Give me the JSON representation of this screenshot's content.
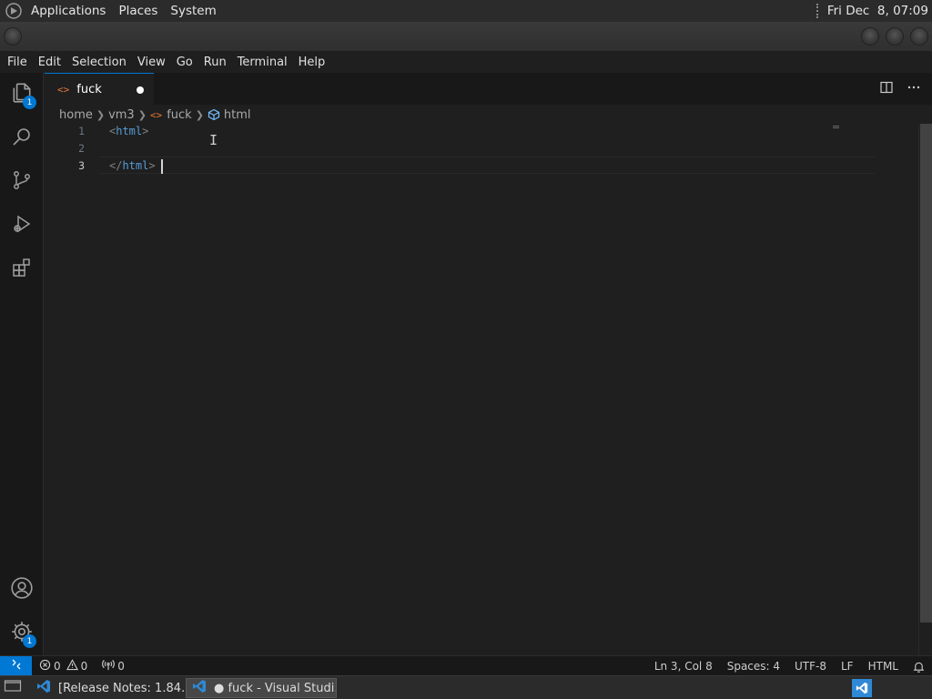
{
  "system_panel": {
    "menus": [
      "Applications",
      "Places",
      "System"
    ],
    "clock": "Fri Dec  8, 07:09"
  },
  "menubar": {
    "items": [
      "File",
      "Edit",
      "Selection",
      "View",
      "Go",
      "Run",
      "Terminal",
      "Help"
    ]
  },
  "activity_bar": {
    "items": [
      {
        "icon": "files-icon",
        "badge": "1"
      },
      {
        "icon": "search-icon"
      },
      {
        "icon": "source-control-icon"
      },
      {
        "icon": "run-debug-icon"
      },
      {
        "icon": "extensions-icon"
      }
    ],
    "bottom": [
      {
        "icon": "account-icon"
      },
      {
        "icon": "manage-gear-icon",
        "badge": "1"
      }
    ]
  },
  "tab": {
    "icon_glyph": "<>",
    "label": "fuck",
    "dirty": true
  },
  "breadcrumb": {
    "items": [
      "home",
      "vm3",
      "fuck",
      "html"
    ]
  },
  "editor": {
    "lines": [
      {
        "number": "1",
        "text": "<html>"
      },
      {
        "number": "2",
        "text": ""
      },
      {
        "number": "3",
        "text": "</html>"
      }
    ],
    "active_line": 3
  },
  "status_bar": {
    "errors": "0",
    "warnings": "0",
    "ports": "0",
    "position": "Ln 3, Col 8",
    "spaces": "Spaces: 4",
    "encoding": "UTF-8",
    "eol": "LF",
    "language": "HTML"
  },
  "taskbar": {
    "tasks": [
      {
        "label": "[Release Notes: 1.84…",
        "active": false
      },
      {
        "label": "● fuck - Visual Studi…",
        "active": true
      }
    ]
  },
  "colors": {
    "accent": "#0078d4",
    "editor_bg": "#1f1f1f",
    "sidebar_bg": "#181818",
    "html_icon": "#e37933",
    "tag_color": "#569cd6"
  }
}
